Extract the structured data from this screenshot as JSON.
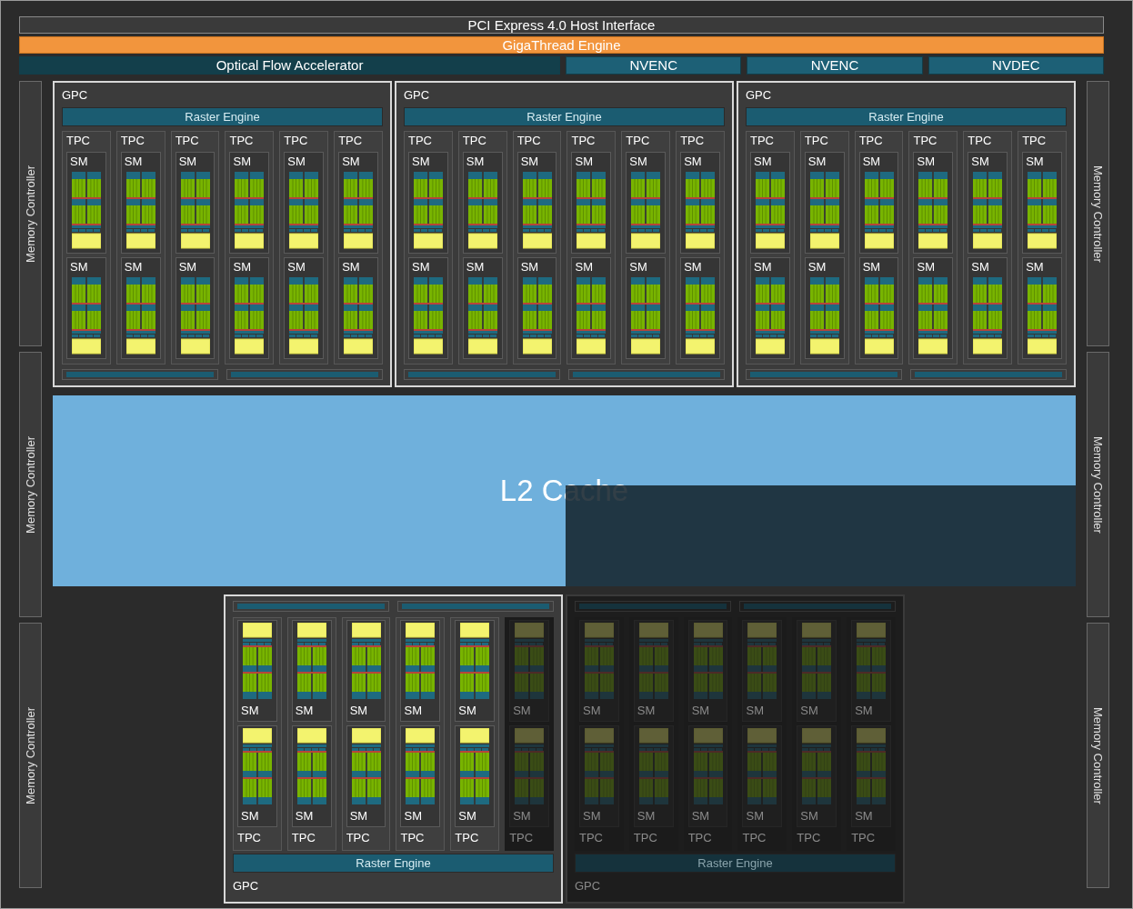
{
  "host_interface": {
    "label": "PCI Express 4.0 Host Interface"
  },
  "gigathread_engine": {
    "label": "GigaThread Engine"
  },
  "engines": [
    {
      "label": "Optical Flow Accelerator"
    },
    {
      "label": "NVENC"
    },
    {
      "label": "NVENC"
    },
    {
      "label": "NVDEC"
    }
  ],
  "memory_controllers_left": [
    "Memory Controller",
    "Memory Controller",
    "Memory Controller"
  ],
  "memory_controllers_right": [
    "Memory Controller",
    "Memory Controller",
    "Memory Controller"
  ],
  "top_gpcs": [
    {
      "label": "GPC",
      "raster_engine": "Raster Engine",
      "disabled": false,
      "tpcs": [
        {
          "label": "TPC",
          "disabled": false,
          "sms": [
            "SM",
            "SM"
          ]
        },
        {
          "label": "TPC",
          "disabled": false,
          "sms": [
            "SM",
            "SM"
          ]
        },
        {
          "label": "TPC",
          "disabled": false,
          "sms": [
            "SM",
            "SM"
          ]
        },
        {
          "label": "TPC",
          "disabled": false,
          "sms": [
            "SM",
            "SM"
          ]
        },
        {
          "label": "TPC",
          "disabled": false,
          "sms": [
            "SM",
            "SM"
          ]
        },
        {
          "label": "TPC",
          "disabled": false,
          "sms": [
            "SM",
            "SM"
          ]
        }
      ]
    },
    {
      "label": "GPC",
      "raster_engine": "Raster Engine",
      "disabled": false,
      "tpcs": [
        {
          "label": "TPC",
          "disabled": false,
          "sms": [
            "SM",
            "SM"
          ]
        },
        {
          "label": "TPC",
          "disabled": false,
          "sms": [
            "SM",
            "SM"
          ]
        },
        {
          "label": "TPC",
          "disabled": false,
          "sms": [
            "SM",
            "SM"
          ]
        },
        {
          "label": "TPC",
          "disabled": false,
          "sms": [
            "SM",
            "SM"
          ]
        },
        {
          "label": "TPC",
          "disabled": false,
          "sms": [
            "SM",
            "SM"
          ]
        },
        {
          "label": "TPC",
          "disabled": false,
          "sms": [
            "SM",
            "SM"
          ]
        }
      ]
    },
    {
      "label": "GPC",
      "raster_engine": "Raster Engine",
      "disabled": false,
      "tpcs": [
        {
          "label": "TPC",
          "disabled": false,
          "sms": [
            "SM",
            "SM"
          ]
        },
        {
          "label": "TPC",
          "disabled": false,
          "sms": [
            "SM",
            "SM"
          ]
        },
        {
          "label": "TPC",
          "disabled": false,
          "sms": [
            "SM",
            "SM"
          ]
        },
        {
          "label": "TPC",
          "disabled": false,
          "sms": [
            "SM",
            "SM"
          ]
        },
        {
          "label": "TPC",
          "disabled": false,
          "sms": [
            "SM",
            "SM"
          ]
        },
        {
          "label": "TPC",
          "disabled": false,
          "sms": [
            "SM",
            "SM"
          ]
        }
      ]
    }
  ],
  "l2_cache": {
    "label": "L2 Cache",
    "disabled_region": true
  },
  "bottom_gpcs": [
    {
      "label": "GPC",
      "raster_engine": "Raster Engine",
      "disabled": false,
      "tpcs": [
        {
          "label": "TPC",
          "disabled": false,
          "sms": [
            "SM",
            "SM"
          ]
        },
        {
          "label": "TPC",
          "disabled": false,
          "sms": [
            "SM",
            "SM"
          ]
        },
        {
          "label": "TPC",
          "disabled": false,
          "sms": [
            "SM",
            "SM"
          ]
        },
        {
          "label": "TPC",
          "disabled": false,
          "sms": [
            "SM",
            "SM"
          ]
        },
        {
          "label": "TPC",
          "disabled": false,
          "sms": [
            "SM",
            "SM"
          ]
        },
        {
          "label": "TPC",
          "disabled": true,
          "sms": [
            "SM",
            "SM"
          ]
        }
      ]
    },
    {
      "label": "GPC",
      "raster_engine": "Raster Engine",
      "disabled": true,
      "tpcs": [
        {
          "label": "TPC",
          "disabled": true,
          "sms": [
            "SM",
            "SM"
          ]
        },
        {
          "label": "TPC",
          "disabled": true,
          "sms": [
            "SM",
            "SM"
          ]
        },
        {
          "label": "TPC",
          "disabled": true,
          "sms": [
            "SM",
            "SM"
          ]
        },
        {
          "label": "TPC",
          "disabled": true,
          "sms": [
            "SM",
            "SM"
          ]
        },
        {
          "label": "TPC",
          "disabled": true,
          "sms": [
            "SM",
            "SM"
          ]
        },
        {
          "label": "TPC",
          "disabled": true,
          "sms": [
            "SM",
            "SM"
          ]
        }
      ]
    }
  ]
}
